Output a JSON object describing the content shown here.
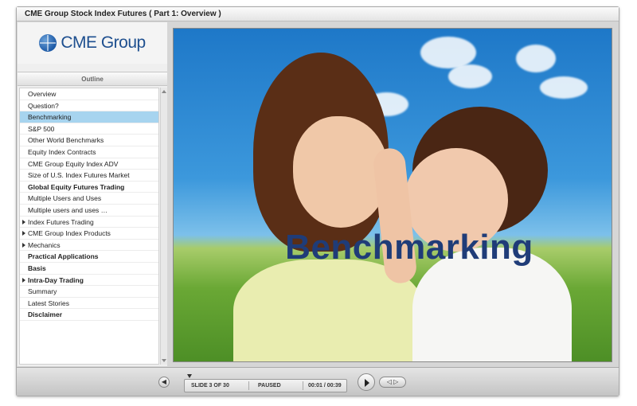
{
  "window": {
    "title": "CME Group Stock Index Futures ( Part 1: Overview )"
  },
  "logo": {
    "text": "CME Group"
  },
  "sidebar": {
    "tab_label": "Outline",
    "items": [
      {
        "label": "Overview",
        "bold": false,
        "expandable": false,
        "selected": false
      },
      {
        "label": "Question?",
        "bold": false,
        "expandable": false,
        "selected": false
      },
      {
        "label": "Benchmarking",
        "bold": false,
        "expandable": false,
        "selected": true
      },
      {
        "label": "S&P 500",
        "bold": false,
        "expandable": false,
        "selected": false
      },
      {
        "label": "Other World Benchmarks",
        "bold": false,
        "expandable": false,
        "selected": false
      },
      {
        "label": "Equity Index Contracts",
        "bold": false,
        "expandable": false,
        "selected": false
      },
      {
        "label": "CME Group Equity Index ADV",
        "bold": false,
        "expandable": false,
        "selected": false
      },
      {
        "label": "Size of U.S. Index Futures Market",
        "bold": false,
        "expandable": false,
        "selected": false
      },
      {
        "label": "Global Equity Futures Trading",
        "bold": true,
        "expandable": false,
        "selected": false
      },
      {
        "label": "Multiple Users and Uses",
        "bold": false,
        "expandable": false,
        "selected": false
      },
      {
        "label": "Multiple users and uses …",
        "bold": false,
        "expandable": false,
        "selected": false
      },
      {
        "label": "Index Futures Trading",
        "bold": false,
        "expandable": true,
        "selected": false
      },
      {
        "label": "CME Group Index Products",
        "bold": false,
        "expandable": true,
        "selected": false
      },
      {
        "label": "Mechanics",
        "bold": false,
        "expandable": true,
        "selected": false
      },
      {
        "label": "Practical Applications",
        "bold": true,
        "expandable": false,
        "selected": false
      },
      {
        "label": "Basis",
        "bold": true,
        "expandable": false,
        "selected": false
      },
      {
        "label": "Intra-Day Trading",
        "bold": true,
        "expandable": true,
        "selected": false
      },
      {
        "label": "Summary",
        "bold": false,
        "expandable": false,
        "selected": false
      },
      {
        "label": "Latest Stories",
        "bold": false,
        "expandable": false,
        "selected": false
      },
      {
        "label": "Disclaimer",
        "bold": true,
        "expandable": false,
        "selected": false
      }
    ]
  },
  "slide": {
    "title": "Benchmarking"
  },
  "player": {
    "slide_counter": "SLIDE 3 OF 30",
    "status": "PAUSED",
    "time": "00:01 / 00:39",
    "prev_next_label": "◁ ▷",
    "volume_icon": "speaker-icon",
    "play_icon": "play-icon"
  }
}
